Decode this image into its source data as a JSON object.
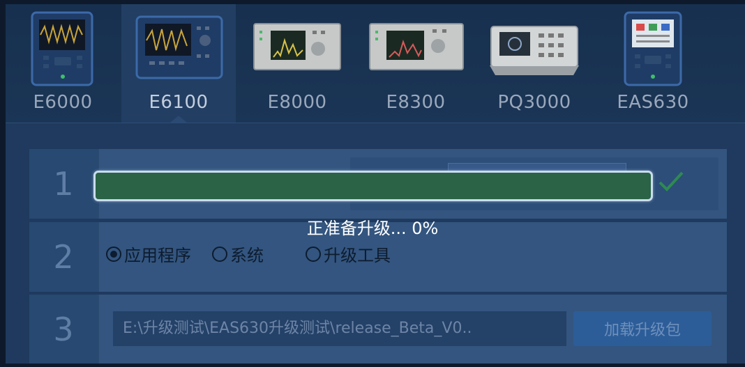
{
  "devices": [
    {
      "label": "E6000",
      "icon": "handheld-analyzer-icon"
    },
    {
      "label": "E6100",
      "icon": "portable-analyzer-icon"
    },
    {
      "label": "E8000",
      "icon": "rack-analyzer-icon"
    },
    {
      "label": "E8300",
      "icon": "rack-analyzer-icon"
    },
    {
      "label": "PQ3000",
      "icon": "benchtop-meter-icon"
    },
    {
      "label": "EAS630",
      "icon": "handheld-tester-icon"
    }
  ],
  "selected_device": "E6100",
  "steps": {
    "step1_number": "1",
    "step2_number": "2",
    "step3_number": "3"
  },
  "upgrade_type": {
    "options": [
      "应用程序",
      "系统",
      "升级工具"
    ],
    "selected": "应用程序"
  },
  "package": {
    "path": "E:\\升级测试\\EAS630升级测试\\release_Beta_V0..",
    "load_button": "加载升级包"
  },
  "progress": {
    "status_text": "正准备升级...   0%",
    "value": 0
  },
  "colors": {
    "background": "#1f3a5e",
    "progress_track": "#2a6346",
    "progress_border": "#c9dcef"
  }
}
